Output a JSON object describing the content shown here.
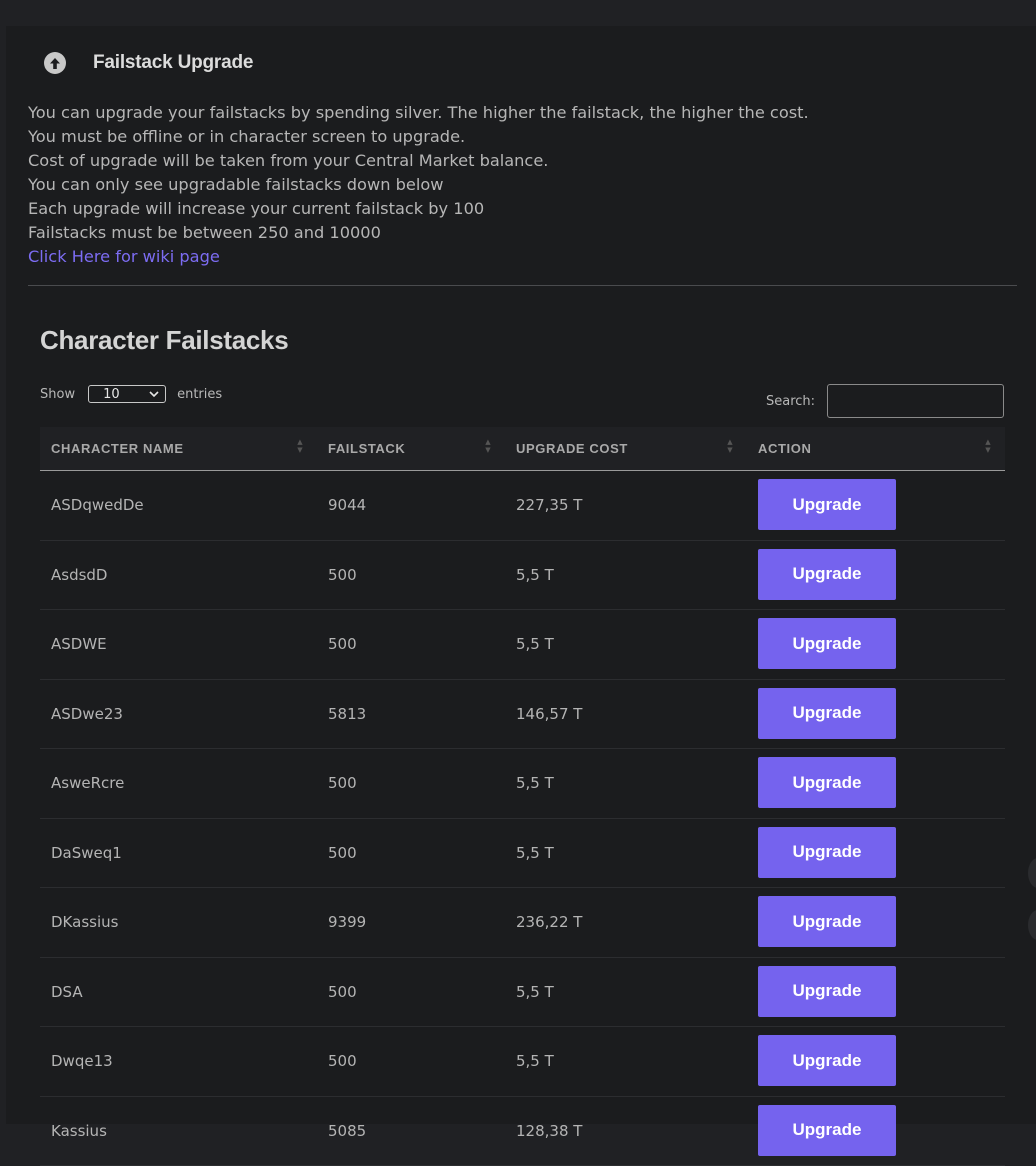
{
  "header": {
    "title": "Failstack Upgrade",
    "icon": "arrow-up-circle-icon"
  },
  "info": {
    "lines": [
      "You can upgrade your failstacks by spending silver. The higher the failstack, the higher the cost.",
      "You must be offline or in character screen to upgrade.",
      "Cost of upgrade will be taken from your Central Market balance.",
      "You can only see upgradable failstacks down below",
      "Each upgrade will increase your current failstack by 100",
      "Failstacks must be between 250 and 10000"
    ],
    "wiki_link": "Click Here for wiki page"
  },
  "section": {
    "title": "Character Failstacks"
  },
  "controls": {
    "show_label": "Show",
    "entries_value": "10",
    "entries_label": "entries",
    "search_label": "Search:",
    "search_value": ""
  },
  "table": {
    "columns": [
      "CHARACTER NAME",
      "FAILSTACK",
      "UPGRADE COST",
      "ACTION"
    ],
    "button_label": "Upgrade",
    "rows": [
      {
        "name": "ASDqwedDe",
        "failstack": "9044",
        "cost": "227,35 T"
      },
      {
        "name": "AsdsdD",
        "failstack": "500",
        "cost": "5,5 T"
      },
      {
        "name": "ASDWE",
        "failstack": "500",
        "cost": "5,5 T"
      },
      {
        "name": "ASDwe23",
        "failstack": "5813",
        "cost": "146,57 T"
      },
      {
        "name": "AsweRcre",
        "failstack": "500",
        "cost": "5,5 T"
      },
      {
        "name": "DaSweq1",
        "failstack": "500",
        "cost": "5,5 T"
      },
      {
        "name": "DKassius",
        "failstack": "9399",
        "cost": "236,22 T"
      },
      {
        "name": "DSA",
        "failstack": "500",
        "cost": "5,5 T"
      },
      {
        "name": "Dwqe13",
        "failstack": "500",
        "cost": "5,5 T"
      },
      {
        "name": "Kassius",
        "failstack": "5085",
        "cost": "128,38 T"
      }
    ]
  },
  "colors": {
    "accent": "#7563ee",
    "link": "#7c6cf2",
    "background": "#1b1c1e"
  }
}
